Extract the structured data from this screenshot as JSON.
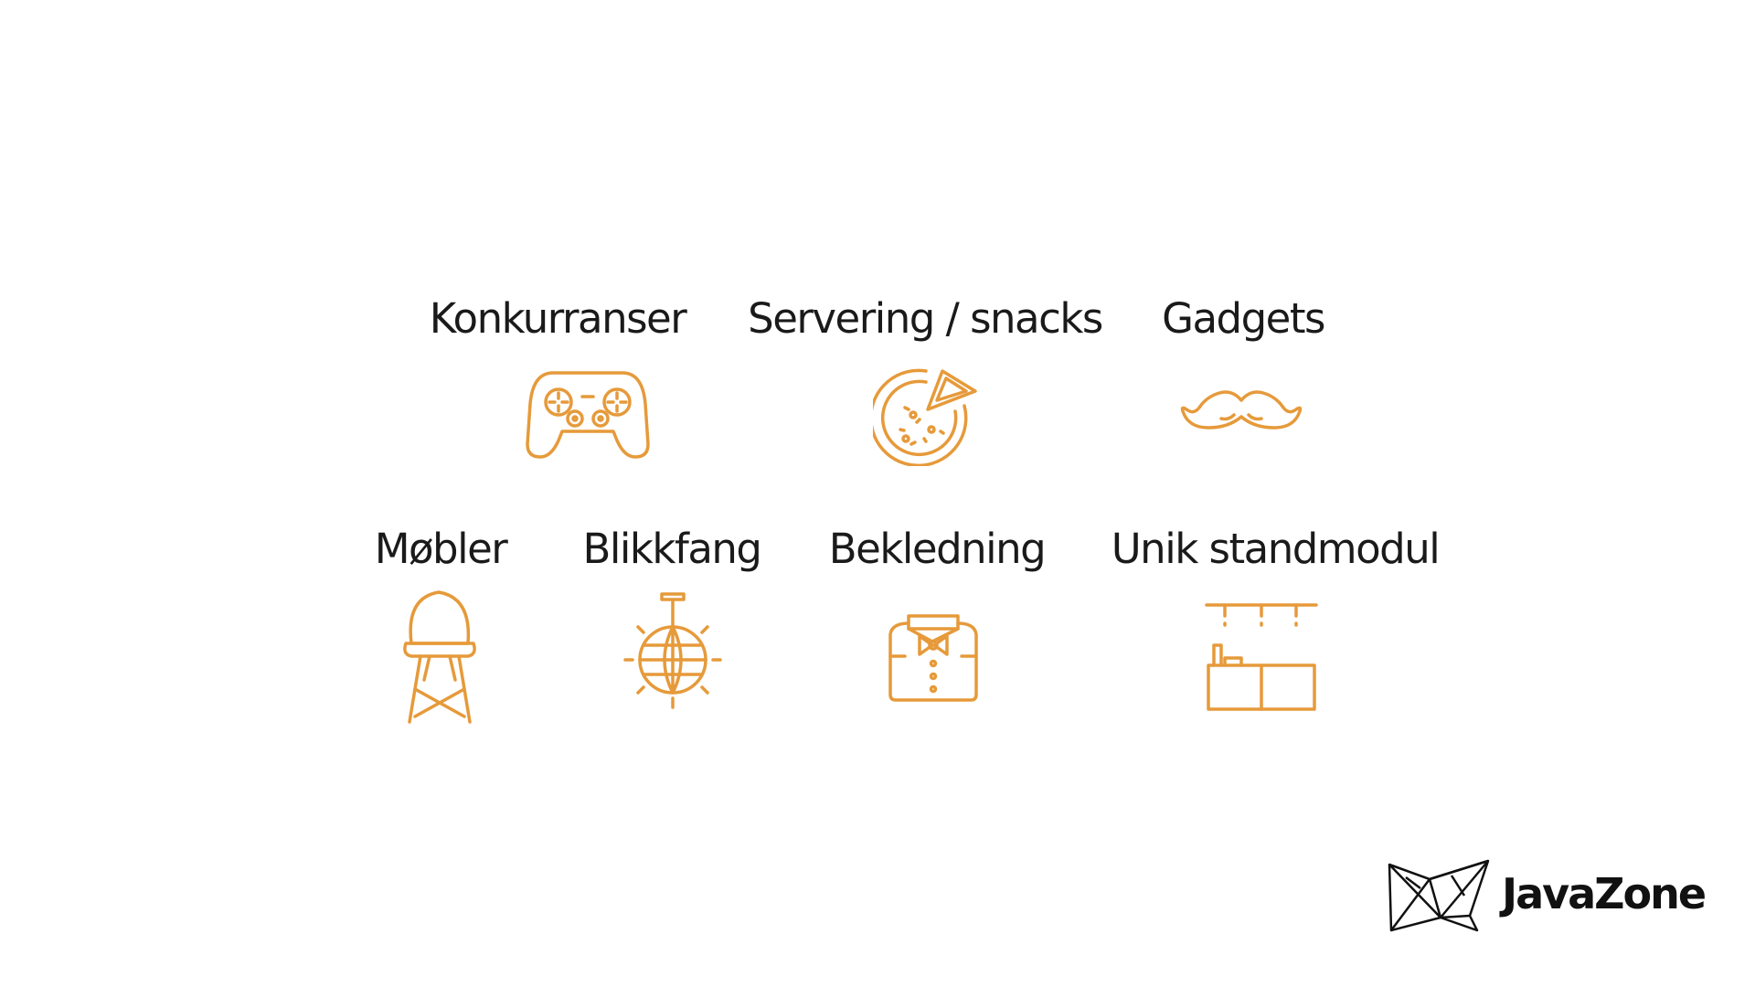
{
  "colors": {
    "accent": "#e69a3a",
    "text": "#1a1a1a"
  },
  "categories": [
    {
      "label": "Konkurranser",
      "icon": "game-controller-icon"
    },
    {
      "label": "Servering / snacks",
      "icon": "pizza-icon"
    },
    {
      "label": "Gadgets",
      "icon": "mustache-icon"
    },
    {
      "label": "Møbler",
      "icon": "chair-icon"
    },
    {
      "label": "Blikkfang",
      "icon": "disco-ball-icon"
    },
    {
      "label": "Bekledning",
      "icon": "shirt-bowtie-icon"
    },
    {
      "label": "Unik standmodul",
      "icon": "stand-module-icon"
    }
  ],
  "logo": {
    "text": "JavaZone",
    "icon": "javazone-logo-icon"
  }
}
